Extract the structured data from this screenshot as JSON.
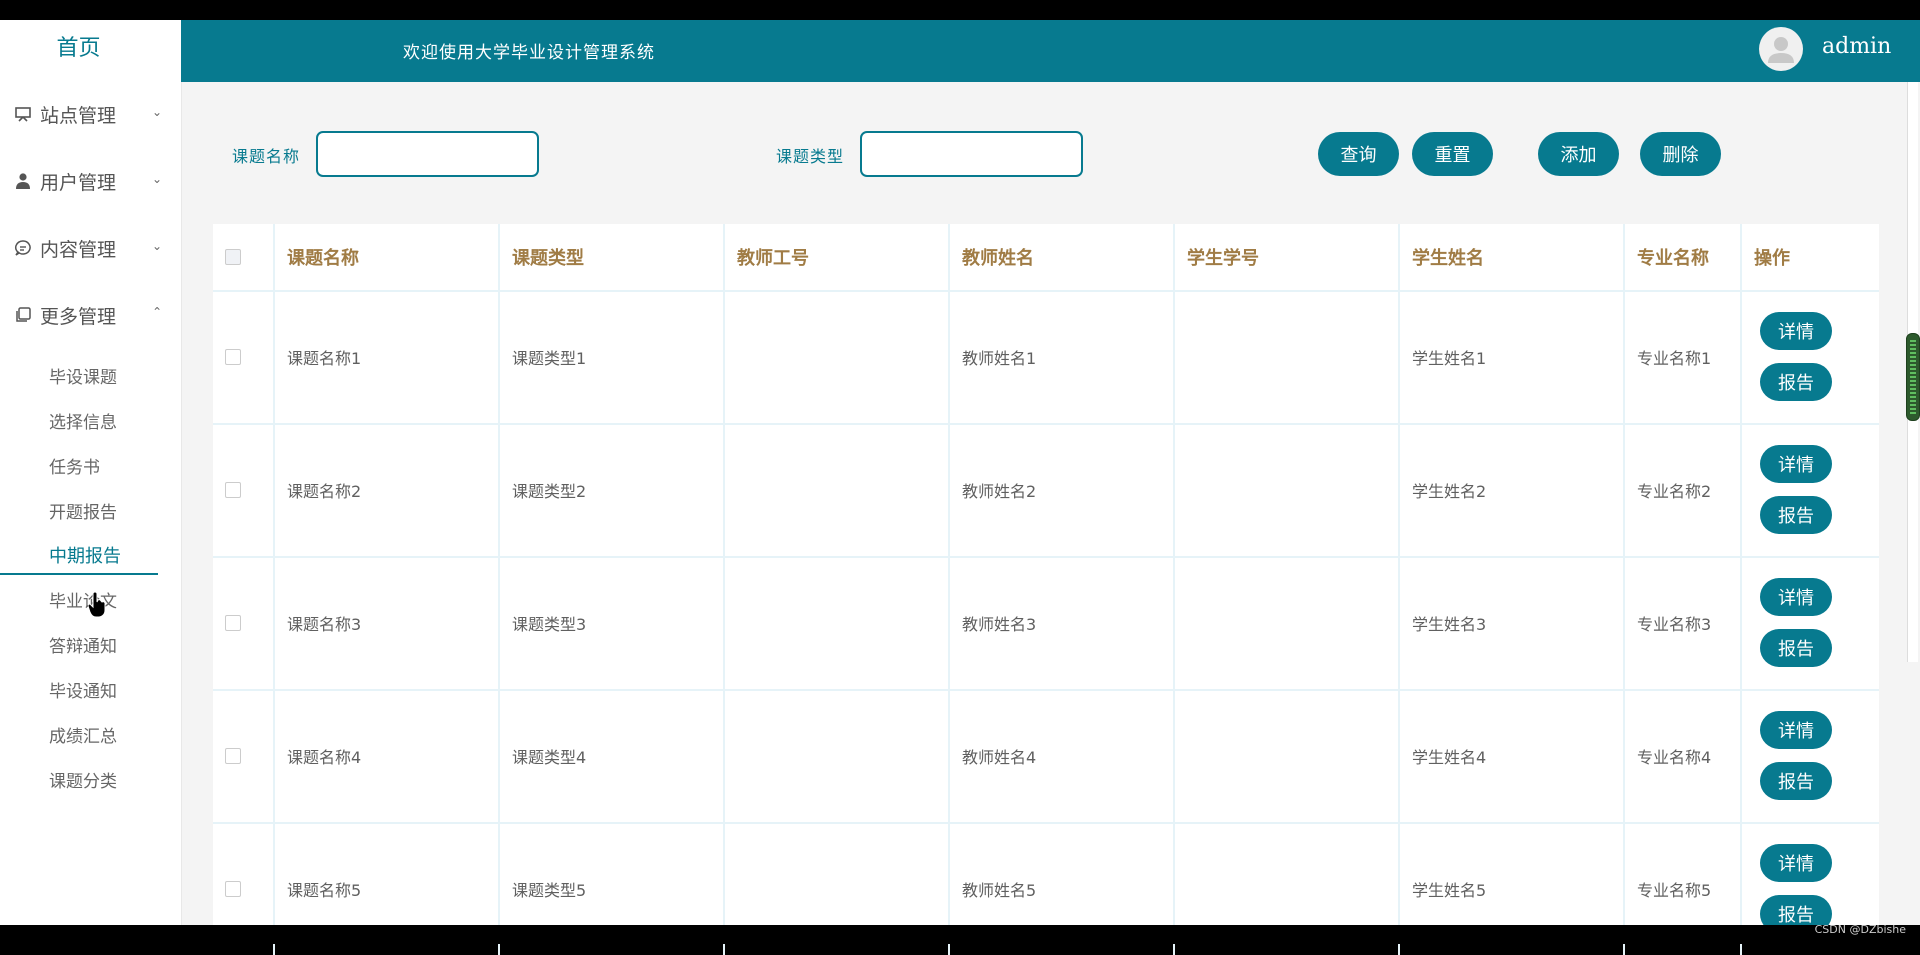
{
  "sidebar": {
    "home": "首页",
    "menus": [
      {
        "label": "站点管理",
        "icon": "monitor-icon"
      },
      {
        "label": "用户管理",
        "icon": "user-icon"
      },
      {
        "label": "内容管理",
        "icon": "chat-icon"
      },
      {
        "label": "更多管理",
        "icon": "copy-icon"
      }
    ],
    "submenu": [
      "毕设课题",
      "选择信息",
      "任务书",
      "开题报告",
      "中期报告",
      "毕业论文",
      "答辩通知",
      "毕设通知",
      "成绩汇总",
      "课题分类"
    ],
    "active_submenu": "中期报告"
  },
  "header": {
    "welcome": "欢迎使用大学毕业设计管理系统",
    "username": "admin"
  },
  "search": {
    "label1": "课题名称",
    "label2": "课题类型",
    "query_btn": "查询",
    "reset_btn": "重置",
    "add_btn": "添加",
    "delete_btn": "删除"
  },
  "table": {
    "columns": [
      "课题名称",
      "课题类型",
      "教师工号",
      "教师姓名",
      "学生学号",
      "学生姓名",
      "专业名称",
      "操作"
    ],
    "rows": [
      {
        "name": "课题名称1",
        "type": "课题类型1",
        "tno": "",
        "tname": "教师姓名1",
        "sno": "",
        "sname": "学生姓名1",
        "major": "专业名称1"
      },
      {
        "name": "课题名称2",
        "type": "课题类型2",
        "tno": "",
        "tname": "教师姓名2",
        "sno": "",
        "sname": "学生姓名2",
        "major": "专业名称2"
      },
      {
        "name": "课题名称3",
        "type": "课题类型3",
        "tno": "",
        "tname": "教师姓名3",
        "sno": "",
        "sname": "学生姓名3",
        "major": "专业名称3"
      },
      {
        "name": "课题名称4",
        "type": "课题类型4",
        "tno": "",
        "tname": "教师姓名4",
        "sno": "",
        "sname": "学生姓名4",
        "major": "专业名称4"
      },
      {
        "name": "课题名称5",
        "type": "课题类型5",
        "tno": "",
        "tname": "教师姓名5",
        "sno": "",
        "sname": "学生姓名5",
        "major": "专业名称5"
      }
    ],
    "detail_btn": "详情",
    "report_btn": "报告"
  },
  "watermark": "CSDN @DZbishe",
  "colors": {
    "accent": "#077a8f",
    "header_text": "#a07c45"
  }
}
